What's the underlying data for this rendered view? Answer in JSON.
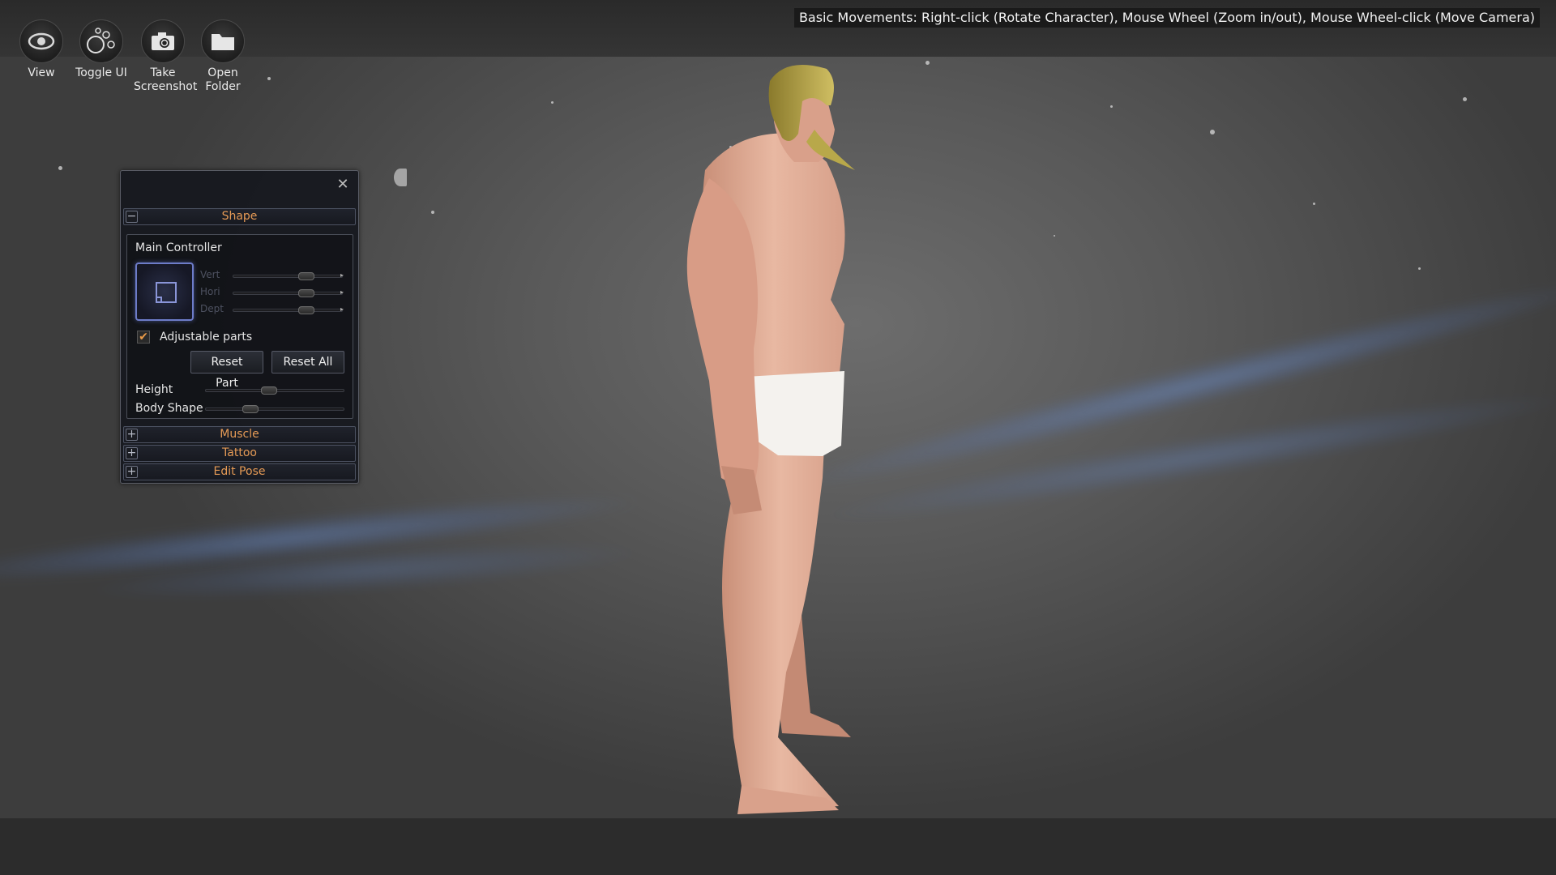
{
  "toolbar": {
    "view": "View",
    "toggle_ui": "Toggle UI",
    "screenshot_line1": "Take",
    "screenshot_line2": "Screenshot",
    "folder_line1": "Open",
    "folder_line2": "Folder"
  },
  "hint": "Basic Movements: Right-click (Rotate Character), Mouse Wheel (Zoom in/out), Mouse Wheel-click (Move Camera)",
  "panel": {
    "close_icon": "close-icon",
    "sections": {
      "shape": "Shape",
      "muscle": "Muscle",
      "tattoo": "Tattoo",
      "edit_pose": "Edit Pose"
    },
    "main_controller": "Main Controller",
    "axes": [
      "Vert",
      "Hori",
      "Dept"
    ],
    "adjustable_parts": "Adjustable parts",
    "adjustable_checked": true,
    "reset_part": "Reset Part",
    "reset_all": "Reset All",
    "height_label": "Height",
    "body_shape_label": "Body Shape",
    "levels": {
      "vert": 0.7,
      "hori": 0.7,
      "dept": 0.7,
      "height": 0.45,
      "body_shape": 0.3
    }
  },
  "colors": {
    "section_text": "#e59a55",
    "controller_border": "#6d7cc9",
    "check_color": "#e89a48"
  }
}
